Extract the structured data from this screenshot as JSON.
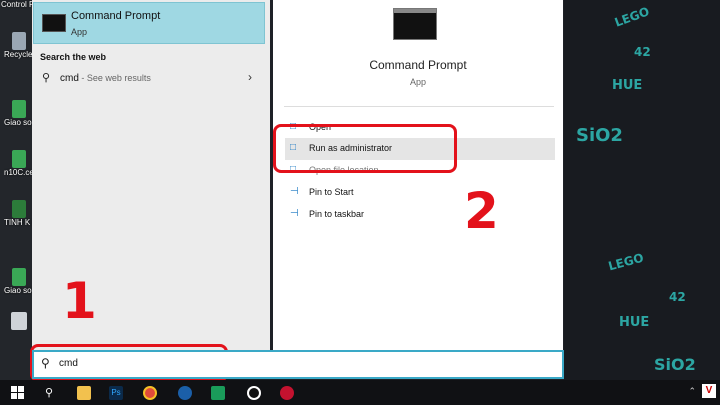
{
  "desktop": {
    "icons": [
      {
        "label": "Control P",
        "color": "#2a6ebd"
      },
      {
        "label": "Recycle",
        "color": "#9aa7b4"
      },
      {
        "label": "Giao so TKMH-",
        "color": "#3aa856"
      },
      {
        "label": "n10C.ce",
        "color": "#3aa856"
      },
      {
        "label": "TINH K CAU AO",
        "color": "#2c7c3a"
      },
      {
        "label": "Giao so TKMH-",
        "color": "#3aa856"
      },
      {
        "label": "",
        "color": "#cfd3d8"
      }
    ]
  },
  "wallpaper": {
    "doodles": [
      "LEGO",
      "HUE",
      "SiO2",
      "42",
      "LEGO",
      "HUE",
      "SiO2",
      "42"
    ]
  },
  "start_menu": {
    "best_match": {
      "title": "Command Prompt",
      "subtitle": "App"
    },
    "search_web_heading": "Search the web",
    "web_result": {
      "query": "cmd",
      "suffix": " - See web results"
    },
    "preview": {
      "title": "Command Prompt",
      "subtitle": "App"
    },
    "actions": [
      {
        "label": "Open",
        "icon": "open-icon"
      },
      {
        "label": "Run as administrator",
        "icon": "shield-icon"
      },
      {
        "label": "Open file location",
        "icon": "folder-icon"
      },
      {
        "label": "Pin to Start",
        "icon": "pin-icon"
      },
      {
        "label": "Pin to taskbar",
        "icon": "pin-icon"
      }
    ]
  },
  "search": {
    "value": "cmd"
  },
  "annotations": {
    "step1": "1",
    "step2": "2",
    "color": "#e3121b"
  },
  "taskbar": {
    "apps": [
      {
        "name": "file-explorer-icon",
        "color": "#f2c14e"
      },
      {
        "name": "photoshop-icon",
        "color": "#0b2a4a",
        "text": "Ps"
      },
      {
        "name": "chrome-icon",
        "color": "#e14b3b"
      },
      {
        "name": "ultraviewer-icon",
        "color": "#1b5fa8"
      },
      {
        "name": "maps-icon",
        "color": "#1a9b5a"
      },
      {
        "name": "record-icon",
        "color": "#e3121b"
      },
      {
        "name": "autocad-icon",
        "color": "#c4122f"
      }
    ]
  }
}
